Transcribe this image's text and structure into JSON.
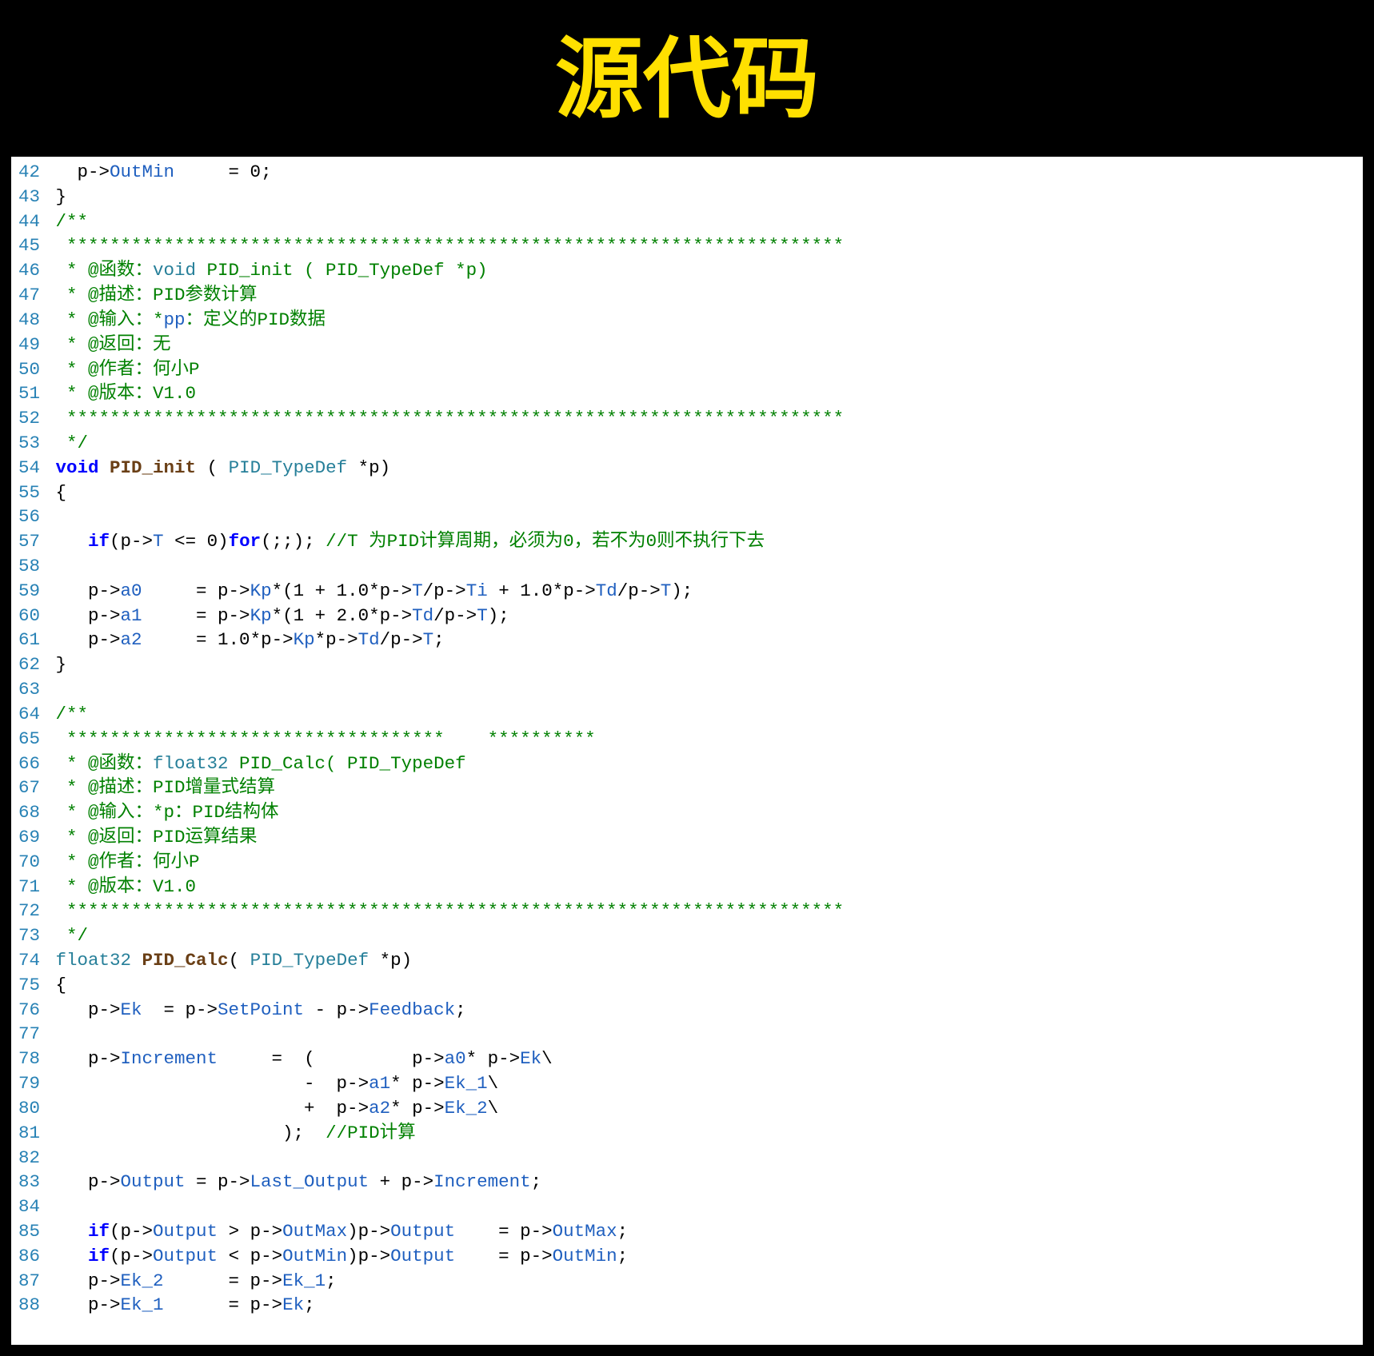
{
  "title": "源代码",
  "lines": [
    {
      "n": "42",
      "t": [
        [
          "op",
          "   p->"
        ],
        [
          "mem",
          "OutMin"
        ],
        [
          "op",
          "     = "
        ],
        [
          "num",
          "0"
        ],
        [
          "op",
          ";"
        ]
      ]
    },
    {
      "n": "43",
      "t": [
        [
          "op",
          " }"
        ]
      ]
    },
    {
      "n": "44",
      "t": [
        [
          "cmt",
          " /**"
        ]
      ]
    },
    {
      "n": "45",
      "t": [
        [
          "cmt",
          "  ************************************************************************"
        ]
      ]
    },
    {
      "n": "46",
      "t": [
        [
          "cmt",
          "  * @函数："
        ],
        [
          "type",
          "void"
        ],
        [
          "cmt",
          " PID_init ( PID_TypeDef *p)"
        ]
      ]
    },
    {
      "n": "47",
      "t": [
        [
          "cmt",
          "  * @描述：PID参数计算"
        ]
      ]
    },
    {
      "n": "48",
      "t": [
        [
          "cmt",
          "  * @输入：*"
        ],
        [
          "mem",
          "pp"
        ],
        [
          "cmt",
          "：定义的PID数据"
        ]
      ]
    },
    {
      "n": "49",
      "t": [
        [
          "cmt",
          "  * @返回：无"
        ]
      ]
    },
    {
      "n": "50",
      "t": [
        [
          "cmt",
          "  * @作者：何小P"
        ]
      ]
    },
    {
      "n": "51",
      "t": [
        [
          "cmt",
          "  * @版本：V1.0"
        ]
      ]
    },
    {
      "n": "52",
      "t": [
        [
          "cmt",
          "  ************************************************************************"
        ]
      ]
    },
    {
      "n": "53",
      "t": [
        [
          "cmt",
          "  */"
        ]
      ]
    },
    {
      "n": "54",
      "t": [
        [
          "kw",
          " void"
        ],
        [
          "op",
          " "
        ],
        [
          "fn",
          "PID_init"
        ],
        [
          "op",
          " ( "
        ],
        [
          "type",
          "PID_TypeDef"
        ],
        [
          "op",
          " *p)"
        ]
      ]
    },
    {
      "n": "55",
      "t": [
        [
          "op",
          " {"
        ]
      ]
    },
    {
      "n": "56",
      "t": [
        [
          "op",
          ""
        ]
      ]
    },
    {
      "n": "57",
      "t": [
        [
          "op",
          "    "
        ],
        [
          "kw",
          "if"
        ],
        [
          "op",
          "(p->"
        ],
        [
          "mem",
          "T"
        ],
        [
          "op",
          " <= "
        ],
        [
          "num",
          "0"
        ],
        [
          "op",
          ")"
        ],
        [
          "kw",
          "for"
        ],
        [
          "op",
          "(;;);"
        ],
        [
          "cmt",
          " //T 为PID计算周期，必须为0，若不为0则不执行下去"
        ]
      ]
    },
    {
      "n": "58",
      "t": [
        [
          "op",
          ""
        ]
      ]
    },
    {
      "n": "59",
      "t": [
        [
          "op",
          "    p->"
        ],
        [
          "mem",
          "a0"
        ],
        [
          "op",
          "     = p->"
        ],
        [
          "mem",
          "Kp"
        ],
        [
          "op",
          "*("
        ],
        [
          "num",
          "1"
        ],
        [
          "op",
          " + "
        ],
        [
          "num",
          "1.0"
        ],
        [
          "op",
          "*p->"
        ],
        [
          "mem",
          "T"
        ],
        [
          "op",
          "/p->"
        ],
        [
          "mem",
          "Ti"
        ],
        [
          "op",
          " + "
        ],
        [
          "num",
          "1.0"
        ],
        [
          "op",
          "*p->"
        ],
        [
          "mem",
          "Td"
        ],
        [
          "op",
          "/p->"
        ],
        [
          "mem",
          "T"
        ],
        [
          "op",
          ");"
        ]
      ]
    },
    {
      "n": "60",
      "t": [
        [
          "op",
          "    p->"
        ],
        [
          "mem",
          "a1"
        ],
        [
          "op",
          "     = p->"
        ],
        [
          "mem",
          "Kp"
        ],
        [
          "op",
          "*("
        ],
        [
          "num",
          "1"
        ],
        [
          "op",
          " + "
        ],
        [
          "num",
          "2.0"
        ],
        [
          "op",
          "*p->"
        ],
        [
          "mem",
          "Td"
        ],
        [
          "op",
          "/p->"
        ],
        [
          "mem",
          "T"
        ],
        [
          "op",
          ");"
        ]
      ]
    },
    {
      "n": "61",
      "t": [
        [
          "op",
          "    p->"
        ],
        [
          "mem",
          "a2"
        ],
        [
          "op",
          "     = "
        ],
        [
          "num",
          "1.0"
        ],
        [
          "op",
          "*p->"
        ],
        [
          "mem",
          "Kp"
        ],
        [
          "op",
          "*p->"
        ],
        [
          "mem",
          "Td"
        ],
        [
          "op",
          "/p->"
        ],
        [
          "mem",
          "T"
        ],
        [
          "op",
          ";"
        ]
      ]
    },
    {
      "n": "62",
      "t": [
        [
          "op",
          " }"
        ]
      ]
    },
    {
      "n": "63",
      "t": [
        [
          "op",
          ""
        ]
      ]
    },
    {
      "n": "64",
      "t": [
        [
          "cmt",
          " /**"
        ]
      ]
    },
    {
      "n": "65",
      "t": [
        [
          "cmt",
          "  ***********************************    **********"
        ]
      ]
    },
    {
      "n": "66",
      "t": [
        [
          "cmt",
          "  * @函数："
        ],
        [
          "type",
          "float32"
        ],
        [
          "cmt",
          " PID_Calc( PID_TypeDef "
        ]
      ]
    },
    {
      "n": "67",
      "t": [
        [
          "cmt",
          "  * @描述：PID增量式结算"
        ]
      ]
    },
    {
      "n": "68",
      "t": [
        [
          "cmt",
          "  * @输入：*p：PID结构体"
        ]
      ]
    },
    {
      "n": "69",
      "t": [
        [
          "cmt",
          "  * @返回：PID运算结果"
        ]
      ]
    },
    {
      "n": "70",
      "t": [
        [
          "cmt",
          "  * @作者：何小P"
        ]
      ]
    },
    {
      "n": "71",
      "t": [
        [
          "cmt",
          "  * @版本：V1.0"
        ]
      ]
    },
    {
      "n": "72",
      "t": [
        [
          "cmt",
          "  ************************************************************************"
        ]
      ]
    },
    {
      "n": "73",
      "t": [
        [
          "cmt",
          "  */"
        ]
      ]
    },
    {
      "n": "74",
      "t": [
        [
          "type",
          " float32"
        ],
        [
          "op",
          " "
        ],
        [
          "fn",
          "PID_Calc"
        ],
        [
          "op",
          "( "
        ],
        [
          "type",
          "PID_TypeDef"
        ],
        [
          "op",
          " *p)"
        ]
      ]
    },
    {
      "n": "75",
      "t": [
        [
          "op",
          " {"
        ]
      ]
    },
    {
      "n": "76",
      "t": [
        [
          "op",
          "    p->"
        ],
        [
          "mem",
          "Ek"
        ],
        [
          "op",
          "  = p->"
        ],
        [
          "mem",
          "SetPoint"
        ],
        [
          "op",
          " - p->"
        ],
        [
          "mem",
          "Feedback"
        ],
        [
          "op",
          ";"
        ]
      ]
    },
    {
      "n": "77",
      "t": [
        [
          "op",
          ""
        ]
      ]
    },
    {
      "n": "78",
      "t": [
        [
          "op",
          "    p->"
        ],
        [
          "mem",
          "Increment"
        ],
        [
          "op",
          "     =  (         p->"
        ],
        [
          "mem",
          "a0"
        ],
        [
          "op",
          "* p->"
        ],
        [
          "mem",
          "Ek"
        ],
        [
          "op",
          "\\"
        ]
      ]
    },
    {
      "n": "79",
      "t": [
        [
          "op",
          "                        -  p->"
        ],
        [
          "mem",
          "a1"
        ],
        [
          "op",
          "* p->"
        ],
        [
          "mem",
          "Ek_1"
        ],
        [
          "op",
          "\\"
        ]
      ]
    },
    {
      "n": "80",
      "t": [
        [
          "op",
          "                        +  p->"
        ],
        [
          "mem",
          "a2"
        ],
        [
          "op",
          "* p->"
        ],
        [
          "mem",
          "Ek_2"
        ],
        [
          "op",
          "\\"
        ]
      ]
    },
    {
      "n": "81",
      "t": [
        [
          "op",
          "                      );  "
        ],
        [
          "cmt",
          "//PID计算"
        ]
      ]
    },
    {
      "n": "82",
      "t": [
        [
          "op",
          ""
        ]
      ]
    },
    {
      "n": "83",
      "t": [
        [
          "op",
          "    p->"
        ],
        [
          "mem",
          "Output"
        ],
        [
          "op",
          " = p->"
        ],
        [
          "mem",
          "Last_Output"
        ],
        [
          "op",
          " + p->"
        ],
        [
          "mem",
          "Increment"
        ],
        [
          "op",
          ";"
        ]
      ]
    },
    {
      "n": "84",
      "t": [
        [
          "op",
          ""
        ]
      ]
    },
    {
      "n": "85",
      "t": [
        [
          "op",
          "    "
        ],
        [
          "kw",
          "if"
        ],
        [
          "op",
          "(p->"
        ],
        [
          "mem",
          "Output"
        ],
        [
          "op",
          " > p->"
        ],
        [
          "mem",
          "OutMax"
        ],
        [
          "op",
          ")p->"
        ],
        [
          "mem",
          "Output"
        ],
        [
          "op",
          "    = p->"
        ],
        [
          "mem",
          "OutMax"
        ],
        [
          "op",
          ";"
        ]
      ]
    },
    {
      "n": "86",
      "t": [
        [
          "op",
          "    "
        ],
        [
          "kw",
          "if"
        ],
        [
          "op",
          "(p->"
        ],
        [
          "mem",
          "Output"
        ],
        [
          "op",
          " < p->"
        ],
        [
          "mem",
          "OutMin"
        ],
        [
          "op",
          ")p->"
        ],
        [
          "mem",
          "Output"
        ],
        [
          "op",
          "    = p->"
        ],
        [
          "mem",
          "OutMin"
        ],
        [
          "op",
          ";"
        ]
      ]
    },
    {
      "n": "87",
      "t": [
        [
          "op",
          "    p->"
        ],
        [
          "mem",
          "Ek_2"
        ],
        [
          "op",
          "      = p->"
        ],
        [
          "mem",
          "Ek_1"
        ],
        [
          "op",
          ";"
        ]
      ]
    },
    {
      "n": "88",
      "t": [
        [
          "op",
          "    p->"
        ],
        [
          "mem",
          "Ek_1"
        ],
        [
          "op",
          "      = p->"
        ],
        [
          "mem",
          "Ek"
        ],
        [
          "op",
          ";"
        ]
      ]
    }
  ]
}
